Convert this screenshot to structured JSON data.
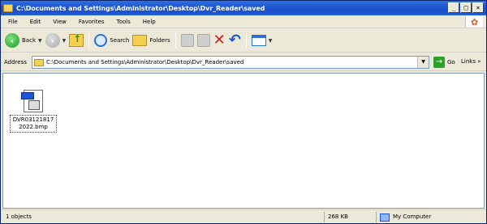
{
  "window": {
    "title": "C:\\Documents and Settings\\Administrator\\Desktop\\Dvr_Reader\\saved",
    "buttons": [
      "_",
      "□",
      "×"
    ]
  },
  "menu": [
    "File",
    "Edit",
    "View",
    "Favorites",
    "Tools",
    "Help"
  ],
  "toolbar": {
    "back_label": "Back",
    "search_label": "Search",
    "folders_label": "Folders"
  },
  "address": {
    "label": "Address",
    "value": "C:\\Documents and Settings\\Administrator\\Desktop\\Dvr_Reader\\saved",
    "go_label": "Go",
    "links_label": "Links »"
  },
  "files": [
    {
      "name": "DVR03121817 2022.bmp",
      "icon": "bmp-file-icon"
    }
  ],
  "status": {
    "objects": "1 objects",
    "size": "268 KB",
    "zone": "My Computer"
  }
}
